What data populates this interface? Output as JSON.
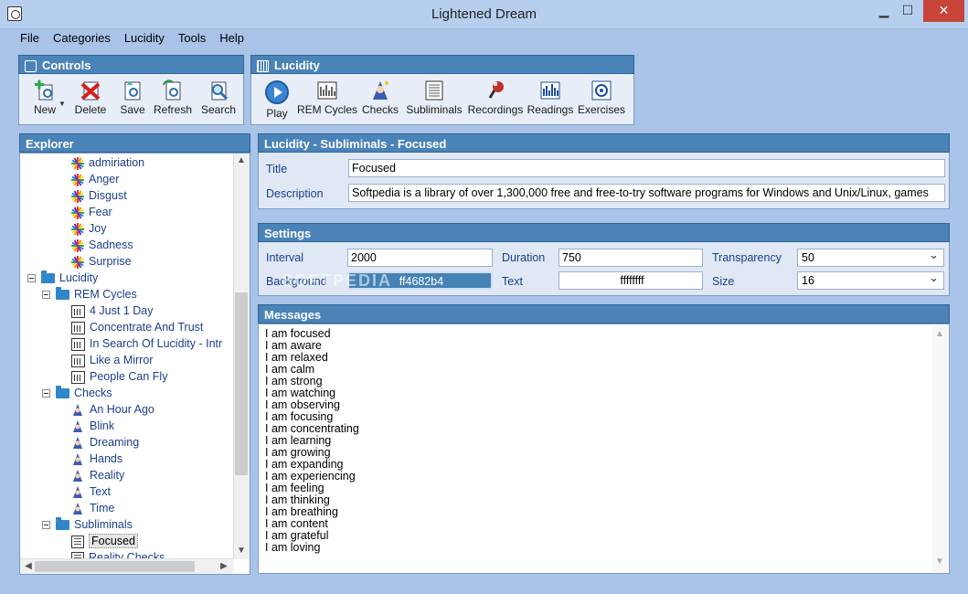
{
  "window": {
    "title": "Lightened Dream"
  },
  "menu": [
    "File",
    "Categories",
    "Lucidity",
    "Tools",
    "Help"
  ],
  "controls": {
    "title": "Controls",
    "buttons": [
      {
        "label": "New",
        "icon": "new-icon"
      },
      {
        "label": "Delete",
        "icon": "delete-icon"
      },
      {
        "label": "Save",
        "icon": "save-icon"
      },
      {
        "label": "Refresh",
        "icon": "refresh-icon"
      },
      {
        "label": "Search",
        "icon": "search-icon"
      }
    ]
  },
  "lucidity_bar": {
    "title": "Lucidity",
    "buttons": [
      {
        "label": "Play",
        "icon": "play-icon"
      },
      {
        "label": "REM Cycles",
        "icon": "rem-cycles-icon"
      },
      {
        "label": "Checks",
        "icon": "checks-icon"
      },
      {
        "label": "Subliminals",
        "icon": "subliminals-icon"
      },
      {
        "label": "Recordings",
        "icon": "recordings-icon"
      },
      {
        "label": "Readings",
        "icon": "readings-icon"
      },
      {
        "label": "Exercises",
        "icon": "exercises-icon"
      }
    ]
  },
  "explorer": {
    "title": "Explorer",
    "items": [
      {
        "label": "admiriation",
        "level": 3,
        "icon": "star"
      },
      {
        "label": "Anger",
        "level": 3,
        "icon": "star"
      },
      {
        "label": "Disgust",
        "level": 3,
        "icon": "star"
      },
      {
        "label": "Fear",
        "level": 3,
        "icon": "star"
      },
      {
        "label": "Joy",
        "level": 3,
        "icon": "star"
      },
      {
        "label": "Sadness",
        "level": 3,
        "icon": "star"
      },
      {
        "label": "Surprise",
        "level": 3,
        "icon": "star"
      },
      {
        "label": "Lucidity",
        "level": 0,
        "icon": "folder",
        "toggle": true
      },
      {
        "label": "REM Cycles",
        "level": 1,
        "icon": "folder",
        "toggle": true
      },
      {
        "label": "4 Just 1 Day",
        "level": 3,
        "icon": "chart"
      },
      {
        "label": "Concentrate And Trust",
        "level": 3,
        "icon": "chart"
      },
      {
        "label": "In Search Of Lucidity - Intr",
        "level": 3,
        "icon": "chart"
      },
      {
        "label": "Like a Mirror",
        "level": 3,
        "icon": "chart"
      },
      {
        "label": "People Can Fly",
        "level": 3,
        "icon": "chart"
      },
      {
        "label": "Checks",
        "level": 1,
        "icon": "folder",
        "toggle": true
      },
      {
        "label": "An Hour Ago",
        "level": 3,
        "icon": "wizard"
      },
      {
        "label": "Blink",
        "level": 3,
        "icon": "wizard"
      },
      {
        "label": "Dreaming",
        "level": 3,
        "icon": "wizard"
      },
      {
        "label": "Hands",
        "level": 3,
        "icon": "wizard"
      },
      {
        "label": "Reality",
        "level": 3,
        "icon": "wizard"
      },
      {
        "label": "Text",
        "level": 3,
        "icon": "wizard"
      },
      {
        "label": "Time",
        "level": 3,
        "icon": "wizard"
      },
      {
        "label": "Subliminals",
        "level": 1,
        "icon": "folder",
        "toggle": true
      },
      {
        "label": "Focused",
        "level": 3,
        "icon": "doc",
        "selected": true
      },
      {
        "label": "Reality Checks",
        "level": 3,
        "icon": "doc"
      }
    ]
  },
  "detail": {
    "header": "Lucidity - Subliminals - Focused",
    "title_label": "Title",
    "title_value": "Focused",
    "description_label": "Description",
    "description_value": "Softpedia is a library of over 1,300,000 free and free-to-try software programs for Windows and Unix/Linux, games"
  },
  "settings": {
    "header": "Settings",
    "interval_label": "Interval",
    "interval_value": "2000",
    "duration_label": "Duration",
    "duration_value": "750",
    "transparency_label": "Transparency",
    "transparency_value": "50",
    "background_label": "Background",
    "background_value": "ff4682b4",
    "background_color": "#4682b4",
    "text_label": "Text",
    "text_value": "ffffffff",
    "size_label": "Size",
    "size_value": "16"
  },
  "messages": {
    "header": "Messages",
    "lines": [
      "I am focused",
      "I am aware",
      "I am relaxed",
      "I am calm",
      "I am strong",
      "I am watching",
      "I am observing",
      "I am focusing",
      "I am concentrating",
      "I am learning",
      "I am growing",
      "I am expanding",
      "I am experiencing",
      "I am feeling",
      "I am thinking",
      "I am breathing",
      "I am content",
      "I am grateful",
      "I am loving"
    ]
  },
  "watermark": "SOFTPEDIA",
  "colors": {
    "header": "#4a83b8",
    "accent_text": "#1c3f8c",
    "close": "#c7443a"
  }
}
